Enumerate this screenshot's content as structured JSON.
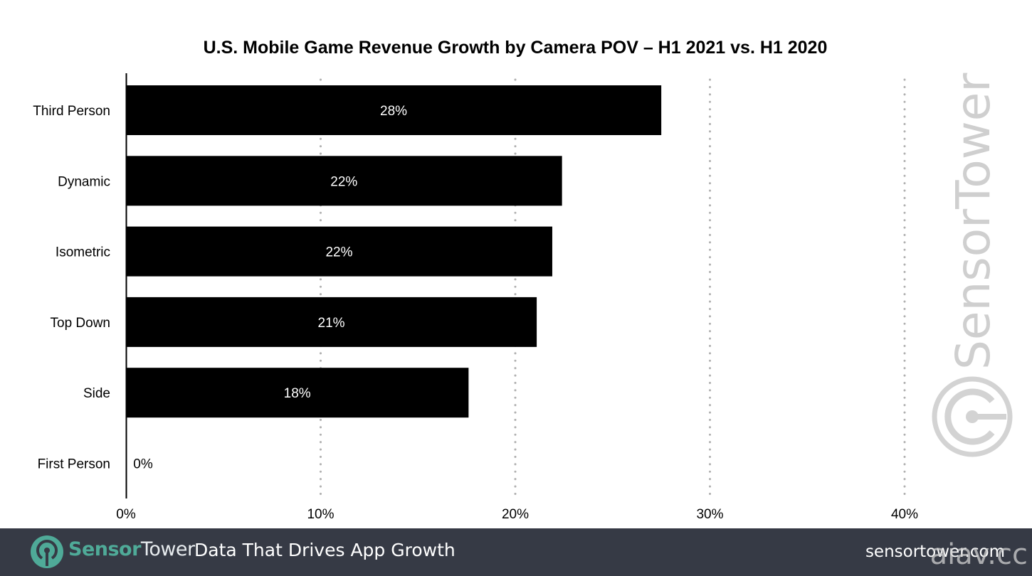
{
  "chart_data": {
    "type": "bar",
    "orientation": "horizontal",
    "title": "U.S. Mobile Game Revenue Growth by Camera POV – H1 2021 vs. H1 2020",
    "xlabel": "",
    "ylabel": "",
    "categories": [
      "Third Person",
      "Dynamic",
      "Isometric",
      "Top Down",
      "Side",
      "First Person"
    ],
    "values": [
      27.5,
      22.4,
      21.9,
      21.1,
      17.6,
      0
    ],
    "data_labels": [
      "28%",
      "22%",
      "22%",
      "21%",
      "18%",
      "0%"
    ],
    "xlim": [
      0,
      40
    ],
    "x_ticks": [
      0,
      10,
      20,
      30,
      40
    ],
    "x_tick_labels": [
      "0%",
      "10%",
      "20%",
      "30%",
      "40%"
    ],
    "grid": "vertical dotted",
    "legend": "none",
    "bar_color": "#000000",
    "watermark": "SensorTower"
  },
  "footer": {
    "brand_part1": "Sensor",
    "brand_part2": "Tower",
    "tagline": "Data That Drives App Growth",
    "url": "sensortower.com",
    "overlay_watermark": "aiav.cc",
    "background_color": "#363a45",
    "brand_color": "#4faa98"
  }
}
